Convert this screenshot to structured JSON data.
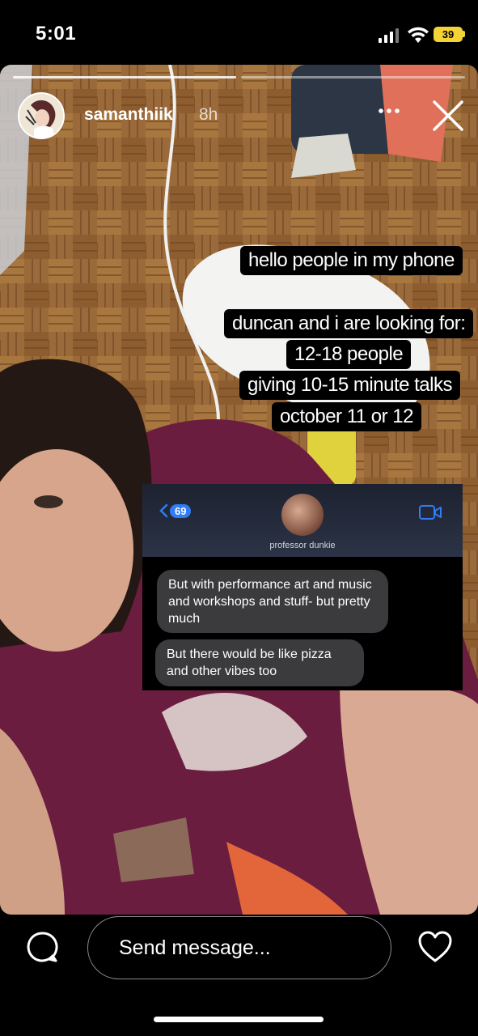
{
  "status_bar": {
    "time": "5:01",
    "battery": "39"
  },
  "story": {
    "username": "samanthiik",
    "time_ago": "8h",
    "captions": [
      "hello people in my phone",
      "duncan and i are looking for:",
      "12-18 people",
      "giving 10-15 minute talks",
      "october 11 or 12"
    ],
    "screenshot": {
      "unread_count": "69",
      "contact_name": "professor dunkie",
      "messages": [
        "But with performance art and music and workshops and stuff- but pretty much",
        "But there would be like pizza and other vibes too"
      ]
    }
  },
  "footer": {
    "message_placeholder": "Send message..."
  },
  "icons": {
    "more": "more-horizontal-icon",
    "close": "close-icon",
    "chat": "chat-bubble-icon",
    "heart": "heart-icon",
    "video": "video-camera-icon"
  }
}
